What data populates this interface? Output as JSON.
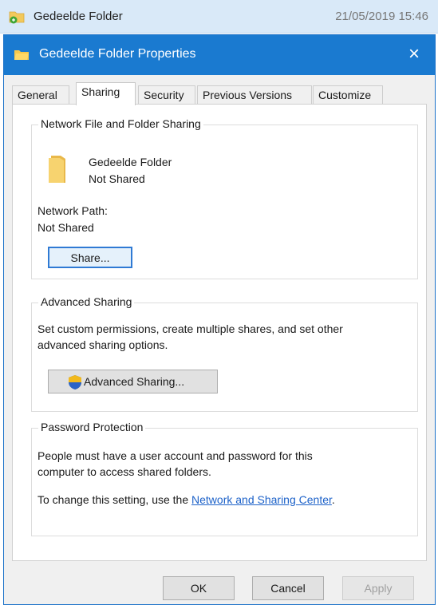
{
  "explorer_row": {
    "name": "Gedeelde Folder",
    "date": "21/05/2019 15:46"
  },
  "dialog": {
    "title": "Gedeelde Folder Properties",
    "close_glyph": "×"
  },
  "tabs": [
    {
      "label": "General"
    },
    {
      "label": "Sharing"
    },
    {
      "label": "Security"
    },
    {
      "label": "Previous Versions"
    },
    {
      "label": "Customize"
    }
  ],
  "active_tab": "Sharing",
  "network_sharing": {
    "legend": "Network File and Folder Sharing",
    "folder_name": "Gedeelde Folder",
    "folder_status": "Not Shared",
    "path_label": "Network Path:",
    "path_value": "Not Shared",
    "share_button": "Share..."
  },
  "advanced_sharing": {
    "legend": "Advanced Sharing",
    "description_line1": "Set custom permissions, create multiple shares, and set other",
    "description_line2": "advanced sharing options.",
    "button": "Advanced Sharing..."
  },
  "password_protection": {
    "legend": "Password Protection",
    "line1": "People must have a user account and password for this",
    "line2": "computer to access shared folders.",
    "change_prefix": "To change this setting, use the ",
    "link": "Network and Sharing Center",
    "change_suffix": "."
  },
  "footer": {
    "ok": "OK",
    "cancel": "Cancel",
    "apply": "Apply"
  },
  "colors": {
    "titlebar": "#1a7ad0",
    "link": "#1d62c9",
    "folder": "#f2c95c"
  },
  "icons": {
    "explorer_row": "shared-folder-icon",
    "titlebar": "folder-icon",
    "close": "close-icon",
    "share_folder": "folder-icon",
    "advanced_button": "uac-shield-icon"
  }
}
